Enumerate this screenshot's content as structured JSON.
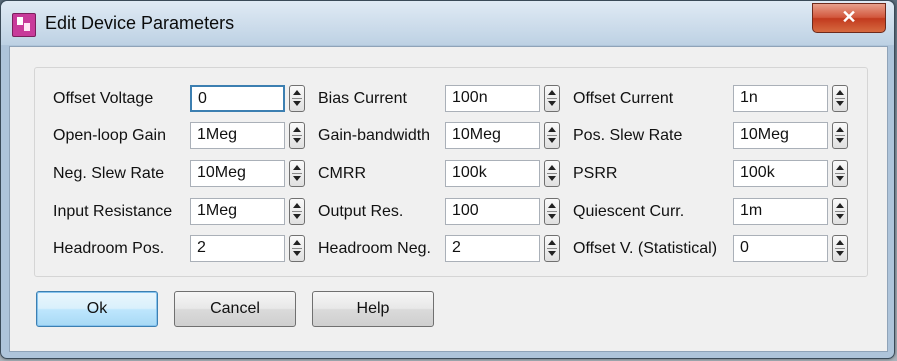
{
  "window": {
    "title": "Edit Device Parameters",
    "close_label": "✕"
  },
  "params": [
    {
      "label": "Offset Voltage",
      "value": "0"
    },
    {
      "label": "Bias Current",
      "value": "100n"
    },
    {
      "label": "Offset Current",
      "value": "1n"
    },
    {
      "label": "Open-loop Gain",
      "value": "1Meg"
    },
    {
      "label": "Gain-bandwidth",
      "value": "10Meg"
    },
    {
      "label": "Pos. Slew Rate",
      "value": "10Meg"
    },
    {
      "label": "Neg. Slew Rate",
      "value": "10Meg"
    },
    {
      "label": "CMRR",
      "value": "100k"
    },
    {
      "label": "PSRR",
      "value": "100k"
    },
    {
      "label": "Input Resistance",
      "value": "1Meg"
    },
    {
      "label": "Output Res.",
      "value": "100"
    },
    {
      "label": "Quiescent Curr.",
      "value": "1m"
    },
    {
      "label": "Headroom Pos.",
      "value": "2"
    },
    {
      "label": "Headroom Neg.",
      "value": "2"
    },
    {
      "label": "Offset V. (Statistical)",
      "value": "0"
    }
  ],
  "buttons": {
    "ok": "Ok",
    "cancel": "Cancel",
    "help": "Help"
  }
}
